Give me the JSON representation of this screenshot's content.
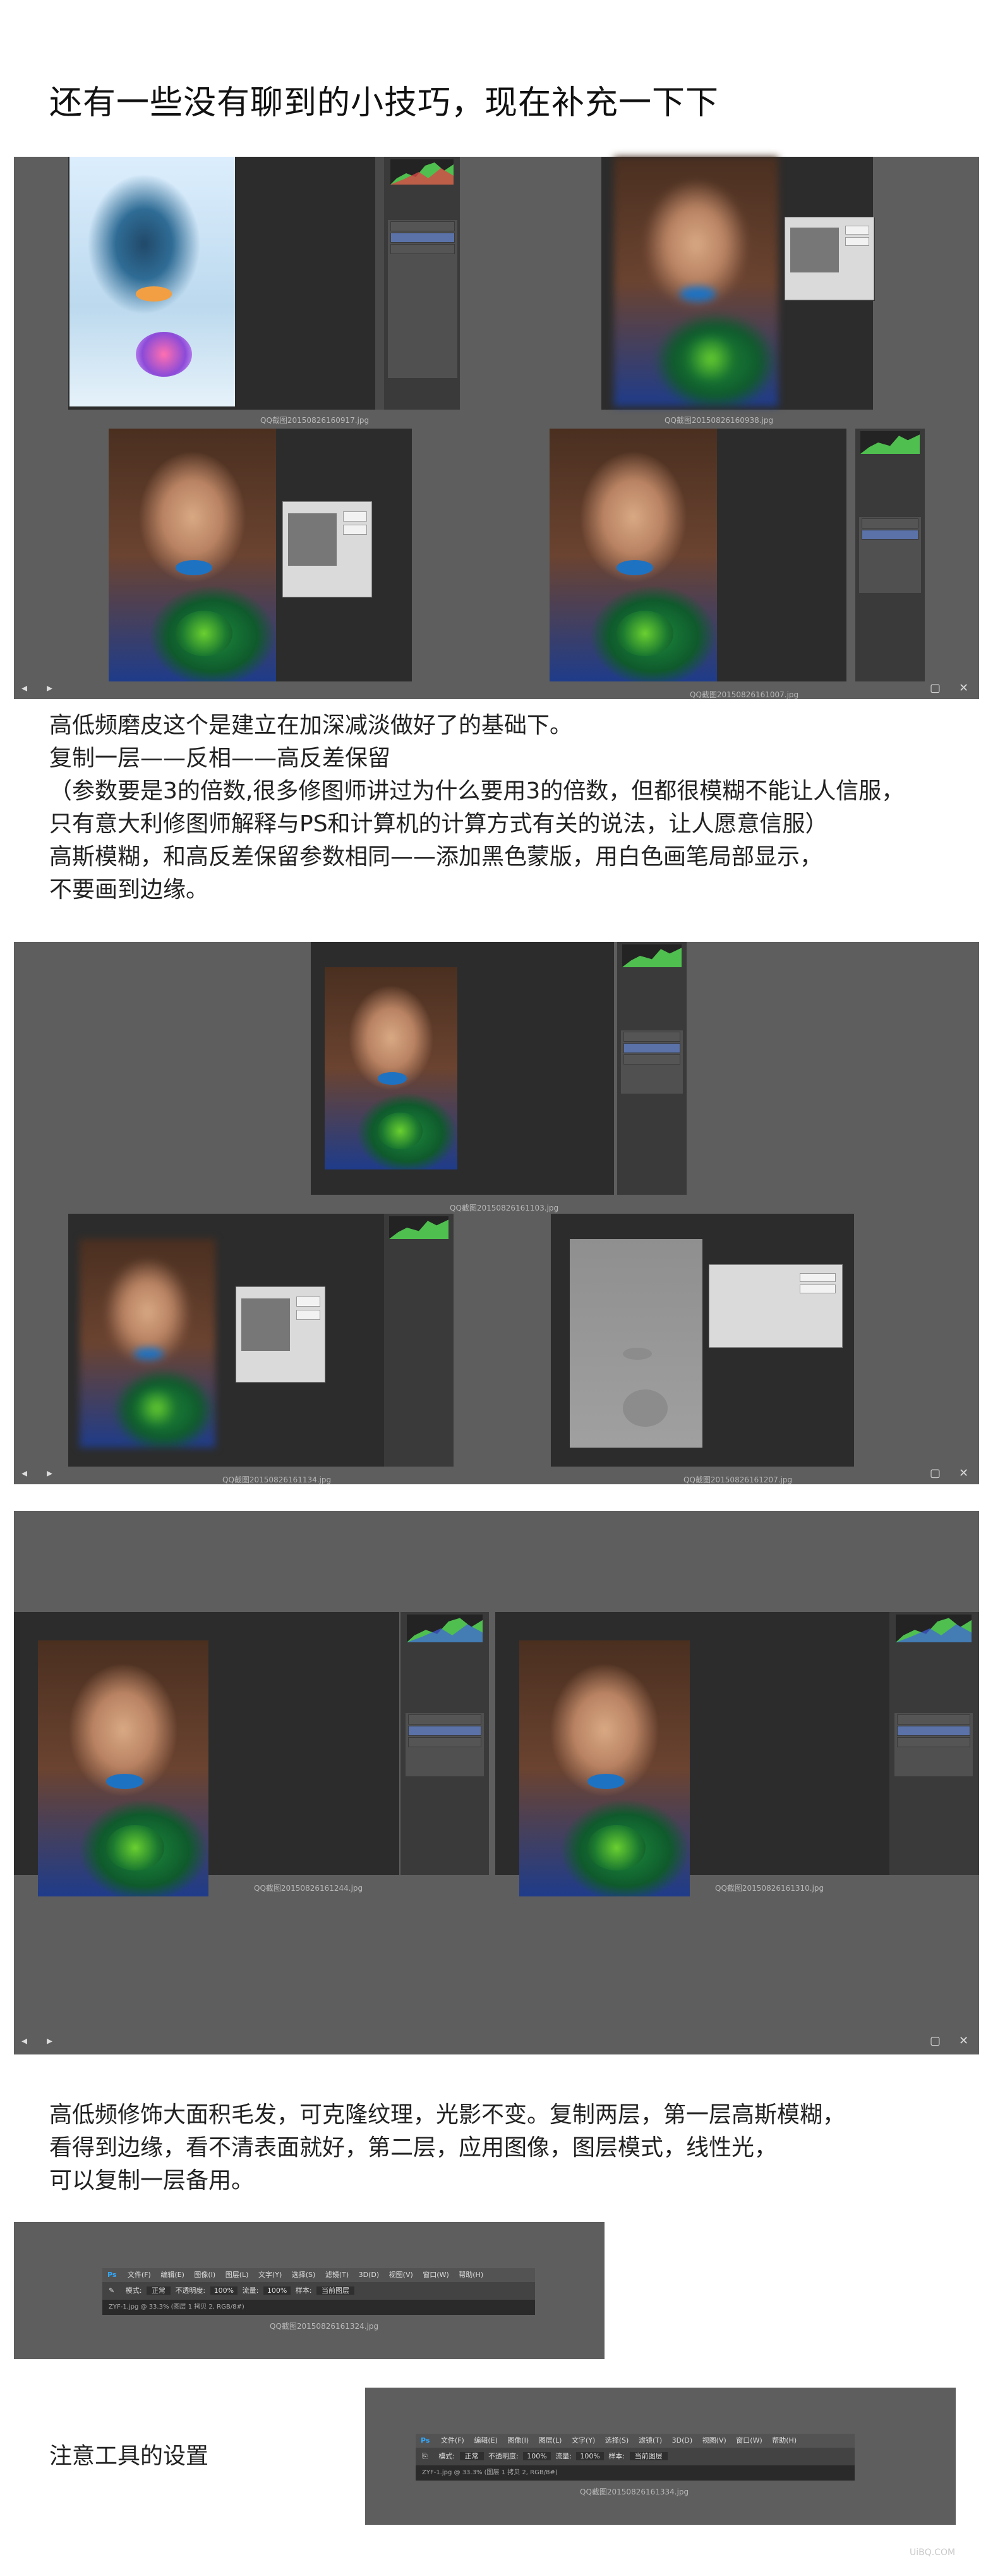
{
  "title": "还有一些没有聊到的小技巧，现在补充一下下",
  "paragraph1": [
    "高低频磨皮这个是建立在加深减淡做好了的基础下。",
    "复制一层——反相——高反差保留",
    "（参数要是3的倍数,很多修图师讲过为什么要用3的倍数，但都很模糊不能让人信服，",
    "只有意大利修图师解释与PS和计算机的计算方式有关的说法，让人愿意信服）",
    "高斯模糊，和高反差保留参数相同——添加黑色蒙版，用白色画笔局部显示，",
    "不要画到边缘。"
  ],
  "paragraph2": [
    "高低频修饰大面积毛发，可克隆纹理，光影不变。复制两层，第一层高斯模糊，",
    "看得到边缘，看不清表面就好，第二层，应用图像，图层模式，线性光，",
    "可以复制一层备用。"
  ],
  "note": "注意工具的设置",
  "captions": {
    "s1a": "QQ截图20150826160917.jpg",
    "s1b": "QQ截图20150826160938.jpg",
    "s1c": "QQ截图20150826161007.jpg",
    "s2a": "QQ截图20150826161103.jpg",
    "s2b": "QQ截图20150826161134.jpg",
    "s2c": "QQ截图20150826161207.jpg",
    "s3a": "QQ截图20150826161244.jpg",
    "s3b": "QQ截图20150826161310.jpg",
    "s4": "QQ截图20150826161324.jpg",
    "s5": "QQ截图20150826161334.jpg"
  },
  "ps_toolbar": {
    "logo": "Ps",
    "menu": [
      "文件(F)",
      "编辑(E)",
      "图像(I)",
      "图层(L)",
      "文字(Y)",
      "选择(S)",
      "滤镜(T)",
      "3D(D)",
      "视图(V)",
      "窗口(W)",
      "帮助(H)"
    ],
    "options": [
      "模式:",
      "正常",
      "不透明度:",
      "100%",
      "流量:",
      "100%",
      "样本:",
      "当前图层"
    ],
    "tab": "ZYF-1.jpg @ 33.3% (图层 1 拷贝 2, RGB/8#)"
  },
  "colors": {
    "panel": "#5e5e5e",
    "canvas": "#2c2c2c",
    "layer_selected": "#5a72a8"
  },
  "icons": {
    "nav_prev": "◂",
    "nav_next": "▸",
    "fullscreen": "▢",
    "close": "✕"
  },
  "watermark": "UiBQ.COM"
}
